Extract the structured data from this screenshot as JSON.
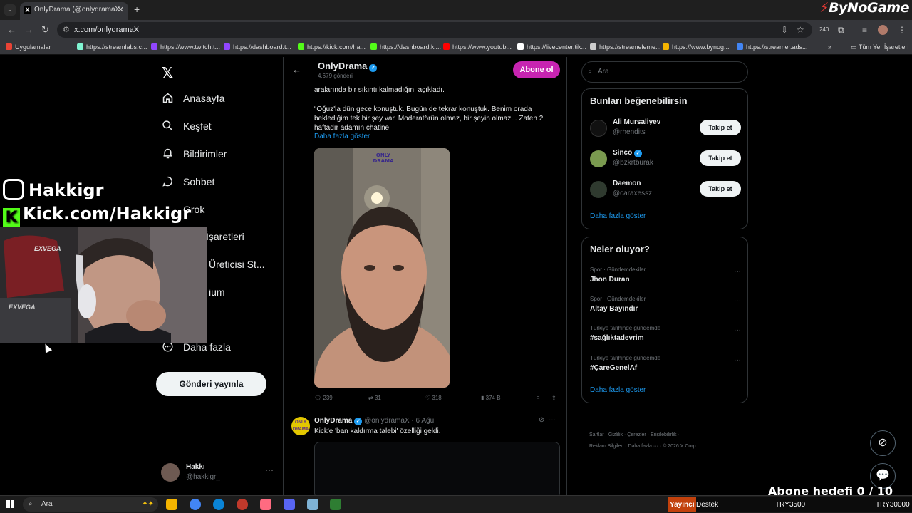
{
  "browser": {
    "tab_title": "OnlyDrama (@onlydramaX",
    "tab_favicon": "X",
    "brand": "ByNoGame",
    "url": "x.com/onlydramaX",
    "extension_badge": "240",
    "bookmarks": [
      {
        "label": "Uygulamalar",
        "color": "#ea4335"
      },
      {
        "label": "https://streamlabs.c...",
        "color": "#80f5d2"
      },
      {
        "label": "https://www.twitch.t...",
        "color": "#9146ff"
      },
      {
        "label": "https://dashboard.t...",
        "color": "#9146ff"
      },
      {
        "label": "https://kick.com/ha...",
        "color": "#53fc18"
      },
      {
        "label": "https://dashboard.ki...",
        "color": "#53fc18"
      },
      {
        "label": "https://www.youtub...",
        "color": "#ff0000"
      },
      {
        "label": "https://livecenter.tik...",
        "color": "#ffffff"
      },
      {
        "label": "https://streameleme...",
        "color": "#cccccc"
      },
      {
        "label": "https://www.bynog...",
        "color": "#f4b400"
      },
      {
        "label": "https://streamer.ads...",
        "color": "#4285f4"
      }
    ],
    "all_bookmarks": "Tüm Yer İşaretleri"
  },
  "nav": {
    "items": [
      "Anasayfa",
      "Keşfet",
      "Bildirimler",
      "Sohbet",
      "Grok",
      "İşaretleri",
      "Üreticisi St...",
      "ium",
      "Daha fazla"
    ],
    "post_button": "Gönderi yayınla",
    "profile_name": "Hakkı",
    "profile_handle": "@hakkigr_"
  },
  "header": {
    "title": "OnlyDrama",
    "subtitle": "4.679 gönderi",
    "subscribe": "Abone ol"
  },
  "post1": {
    "line1": "aralarında bir sıkıntı kalmadığını açıkladı.",
    "quote": "“Oğuz'la dün gece konuştuk. Bugün de tekrar konuştuk. Benim orada beklediğim tek bir şey var. Moderatörün olmaz, bir şeyin olmaz... Zaten 2 haftadır adamın chatine",
    "show_more": "Daha fazla göster",
    "image_watermark": "ONLY DRAMA",
    "replies": "239",
    "reposts": "31",
    "likes": "318",
    "views": "374 B"
  },
  "post2": {
    "name": "OnlyDrama",
    "handle": "@onlydramaX",
    "date": "6 Ağu",
    "text": "Kick'e 'ban kaldırma talebi' özelliği geldi.",
    "avatar_text": "ONLY DRAMA"
  },
  "search": {
    "placeholder": "Ara"
  },
  "who_to_follow": {
    "title": "Bunları beğenebilirsin",
    "follow_label": "Takip et",
    "items": [
      {
        "name": "Ali Mursaliyev",
        "handle": "@rhendits",
        "color": "#111111"
      },
      {
        "name": "Sinco",
        "handle": "@bzkrtburak",
        "color": "#7a9a4f"
      },
      {
        "name": "Daemon",
        "handle": "@caraxessz",
        "color": "#2f3a2f"
      }
    ],
    "show_more": "Daha fazla göster"
  },
  "trends": {
    "title": "Neler oluyor?",
    "items": [
      {
        "context": "Spor · Gündemdekiler",
        "name": "Jhon Duran"
      },
      {
        "context": "Spor · Gündemdekiler",
        "name": "Altay Bayındır"
      },
      {
        "context": "Türkiye tarihinde gündemde",
        "name": "#sağlıktadevrim"
      },
      {
        "context": "Türkiye tarihinde gündemde",
        "name": "#ÇareGenelAf"
      }
    ],
    "show_more": "Daha fazla göster"
  },
  "footer": {
    "line1": "Şartlar  ·  Gizlilik  ·  Çerezler  ·  Erişilebilirlik  ·",
    "line2": "Reklam Bilgileri  ·  Daha fazla ···  ·  © 2026 X Corp."
  },
  "overlay": {
    "instagram": "Hakkigr",
    "kick": "Kick.com/Hakkigr",
    "kick_icon": "K",
    "webcam_brand": "EXVEGA",
    "goal": "Abone hedefi 0 / 10"
  },
  "taskbar": {
    "search": "Ara",
    "ticker_badge": "Yayıncı",
    "ticker_title": "Destek",
    "ticker_amount1": "TRY3500",
    "ticker_amount2": "TRY30000"
  }
}
